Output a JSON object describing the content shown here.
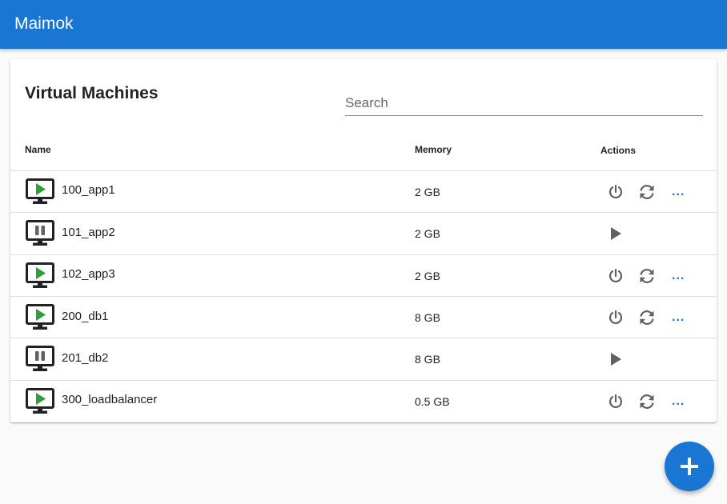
{
  "app": {
    "title": "Maimok"
  },
  "main": {
    "title": "Virtual Machines",
    "search_placeholder": "Search",
    "columns": {
      "name": "Name",
      "memory": "Memory",
      "actions": "Actions"
    },
    "machines": [
      {
        "name": "100_app1",
        "memory": "2 GB",
        "status": "running"
      },
      {
        "name": "101_app2",
        "memory": "2 GB",
        "status": "paused"
      },
      {
        "name": "102_app3",
        "memory": "2 GB",
        "status": "running"
      },
      {
        "name": "200_db1",
        "memory": "8 GB",
        "status": "running"
      },
      {
        "name": "201_db2",
        "memory": "8 GB",
        "status": "paused"
      },
      {
        "name": "300_loadbalancer",
        "memory": "0.5 GB",
        "status": "running"
      }
    ],
    "more_label": "..."
  },
  "icons": {
    "monitor": "monitor-icon",
    "running": "play-icon",
    "paused": "pause-icon",
    "power": "power-icon",
    "restart": "refresh-icon",
    "start": "play-icon",
    "add": "plus-icon"
  },
  "colors": {
    "primary": "#1976d2",
    "running_green": "#2e9e3a",
    "paused_gray": "#616161",
    "action_gray": "#616161"
  }
}
